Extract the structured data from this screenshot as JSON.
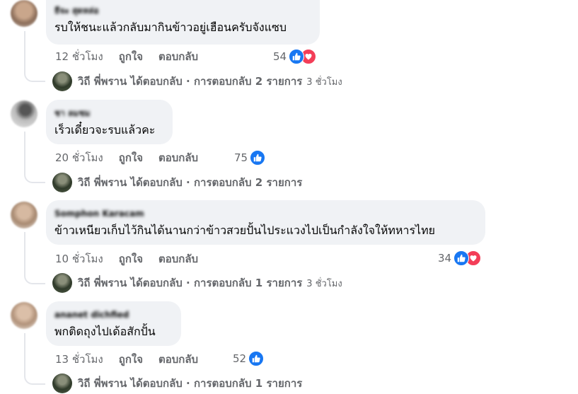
{
  "comments": [
    {
      "author": "ธีจะ สุดหล่อ",
      "text": "รบให้ชนะแล้วกลับมากินข้าวอยู่เฮือนครับจังแซบ",
      "time": "12 ชั่วโมง",
      "like_label": "ถูกใจ",
      "reply_label": "ตอบกลับ",
      "reaction_count": "54",
      "reactions": [
        "like-icon",
        "love-icon"
      ],
      "reply_summary": "วิถี พี่พราน ได้ตอบกลับ · การตอบกลับ 2 รายการ",
      "reply_time": "3 ชั่วโมง"
    },
    {
      "author": "ชา ลมชม",
      "text": "เร็วเดี๋ยวจะรบแล้วคะ",
      "time": "20 ชั่วโมง",
      "like_label": "ถูกใจ",
      "reply_label": "ตอบกลับ",
      "reaction_count": "75",
      "reactions": [
        "like-icon"
      ],
      "reply_summary": "วิถี พี่พราน ได้ตอบกลับ · การตอบกลับ 2 รายการ",
      "reply_time": ""
    },
    {
      "author": "Somphon Karacam",
      "text": "ข้าวเหนียวเก็บไว้กินได้นานกว่าข้าวสวยปั้นไประแวงไปเป็นกำลังใจให้ทหารไทย",
      "time": "10 ชั่วโมง",
      "like_label": "ถูกใจ",
      "reply_label": "ตอบกลับ",
      "reaction_count": "34",
      "reactions": [
        "like-icon",
        "love-icon"
      ],
      "reply_summary": "วิถี พี่พราน ได้ตอบกลับ · การตอบกลับ 1 รายการ",
      "reply_time": "3 ชั่วโมง"
    },
    {
      "author": "ananet dichfied",
      "text": "พกติดถุงไปเด้อสักปั้น",
      "time": "13 ชั่วโมง",
      "like_label": "ถูกใจ",
      "reply_label": "ตอบกลับ",
      "reaction_count": "52",
      "reactions": [
        "like-icon"
      ],
      "reply_summary": "วิถี พี่พราน ได้ตอบกลับ · การตอบกลับ 1 รายการ",
      "reply_time": ""
    }
  ],
  "colors": {
    "bubble": "#f0f2f5",
    "meta_text": "#65676b",
    "like": "#1877f2",
    "love": "#f33e58",
    "thread": "#e4e6eb"
  }
}
